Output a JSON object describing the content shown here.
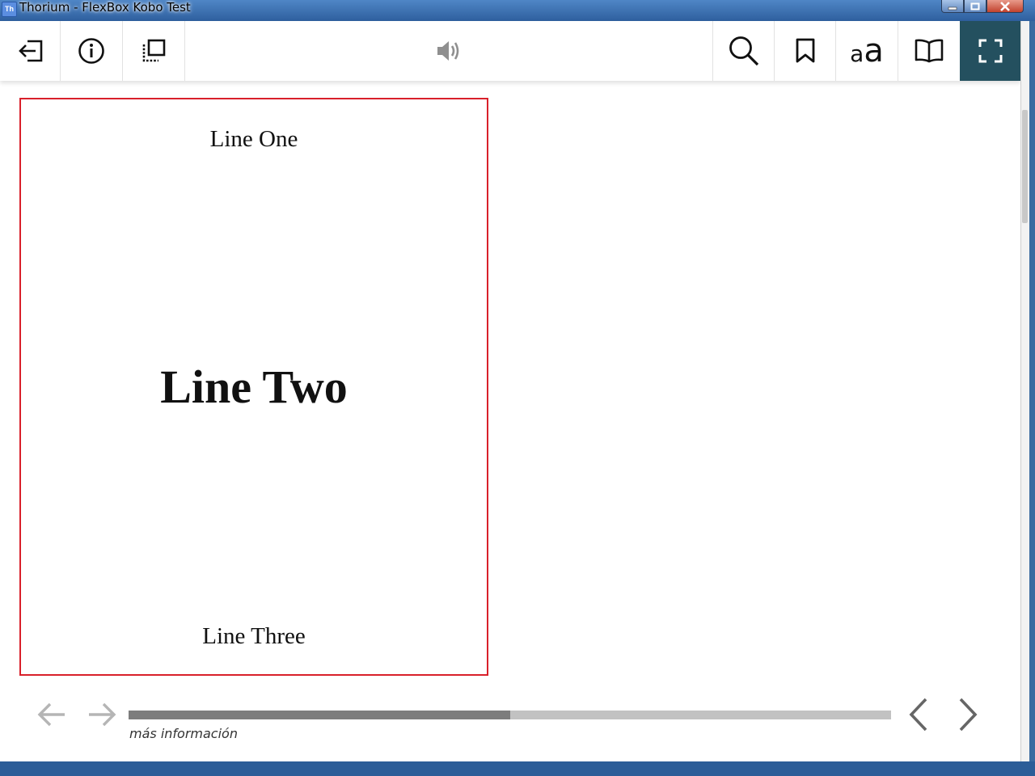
{
  "window": {
    "title": "Thorium - FlexBox Kobo Test",
    "app_icon_text": "Th"
  },
  "toolbar": {
    "left_buttons": [
      "exit-icon",
      "info-icon",
      "toc-icon"
    ],
    "center_button": "speaker-icon",
    "right_buttons": [
      "search-icon",
      "bookmark-icon",
      "text-settings-icon",
      "reading-mode-icon",
      "fullscreen-icon"
    ],
    "text_settings_small": "a",
    "text_settings_large": "a",
    "active_color": "#24505f"
  },
  "page": {
    "line_one": "Line One",
    "line_two": "Line Two",
    "line_three": "Line Three",
    "border_color": "#d9202a"
  },
  "footer": {
    "progress_fraction": 0.5,
    "more_info": "más información"
  }
}
